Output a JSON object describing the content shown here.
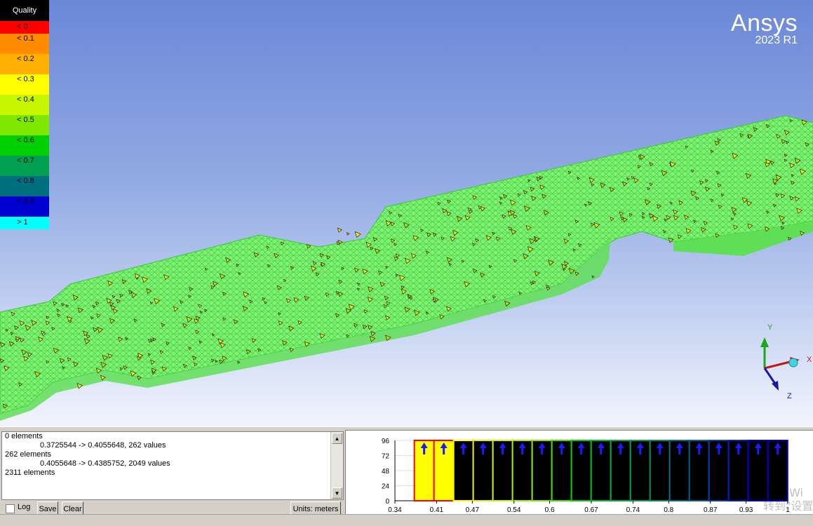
{
  "legend": {
    "title": "Quality",
    "items": [
      {
        "label": "< 0",
        "color": "#ff0000"
      },
      {
        "label": "< 0.1",
        "color": "#ff8c00"
      },
      {
        "label": "< 0.2",
        "color": "#ffb000"
      },
      {
        "label": "< 0.3",
        "color": "#ffff00"
      },
      {
        "label": "< 0.4",
        "color": "#c8f500"
      },
      {
        "label": "< 0.5",
        "color": "#80e800"
      },
      {
        "label": "< 0.6",
        "color": "#00d000"
      },
      {
        "label": "< 0.7",
        "color": "#00a050"
      },
      {
        "label": "< 0.8",
        "color": "#007080"
      },
      {
        "label": "< 0.9",
        "color": "#0000d0"
      },
      {
        "label": "> 1",
        "color": "#00ffff"
      }
    ]
  },
  "brand": {
    "name": "Ansys",
    "version": "2023 R1"
  },
  "triad": {
    "y": "Y",
    "x": "X",
    "z": "Z"
  },
  "console": {
    "lines": [
      {
        "text": "0 elements",
        "indent": false
      },
      {
        "text": "0.3725544 -> 0.4055648, 262 values",
        "indent": true
      },
      {
        "text": "262 elements",
        "indent": false
      },
      {
        "text": "0.4055648 -> 0.4385752, 2049 values",
        "indent": true
      },
      {
        "text": "2311 elements",
        "indent": false
      }
    ]
  },
  "controls": {
    "log_label": "Log",
    "save_label": "Save",
    "clear_label": "Clear",
    "units_label": "Units: meters"
  },
  "chart_data": {
    "type": "bar",
    "x_ticks": [
      "0.34",
      "0.41",
      "0.47",
      "0.54",
      "0.6",
      "0.67",
      "0.74",
      "0.8",
      "0.87",
      "0.93",
      "1"
    ],
    "y_ticks": [
      "0",
      "24",
      "48",
      "72",
      "96"
    ],
    "ylim": [
      0,
      96
    ],
    "xlim": [
      0.34,
      1.0
    ],
    "bins": 19,
    "bin_start": 0.3725544,
    "bin_width": 0.0330104,
    "selected_bins": [
      0,
      1
    ],
    "values": [
      96,
      96,
      96,
      96,
      96,
      96,
      96,
      96,
      96,
      96,
      96,
      96,
      96,
      96,
      96,
      96,
      96,
      96,
      96
    ],
    "selected_color": "#ffff00",
    "unselected_color": "#000000"
  },
  "watermark": {
    "line1": "激活 Wi",
    "line2": "转到\"设置\""
  }
}
